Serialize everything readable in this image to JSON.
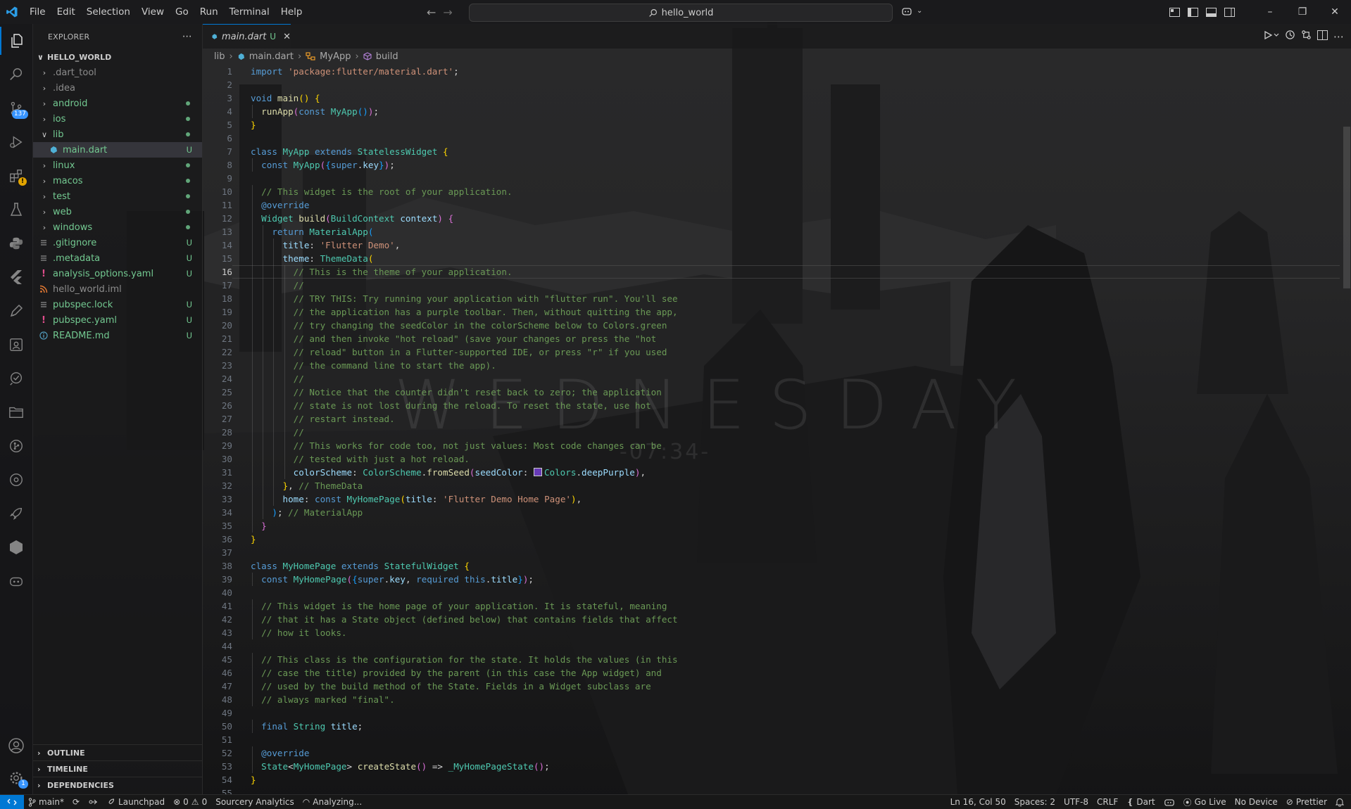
{
  "menu": [
    "File",
    "Edit",
    "Selection",
    "View",
    "Go",
    "Run",
    "Terminal",
    "Help"
  ],
  "command_center": "hello_world",
  "activity": {
    "source_control_badge": "137",
    "settings_badge": "1"
  },
  "explorer": {
    "title": "EXPLORER",
    "root": "HELLO_WORLD",
    "items": [
      {
        "label": ".dart_tool",
        "kind": "folder",
        "open": false,
        "indent": 0,
        "git": "",
        "color": "#8c8c8c",
        "dot": false
      },
      {
        "label": ".idea",
        "kind": "folder",
        "open": false,
        "indent": 0,
        "git": "",
        "color": "#8c8c8c",
        "dot": false
      },
      {
        "label": "android",
        "kind": "folder",
        "open": false,
        "indent": 0,
        "git": "",
        "color": "#73c991",
        "dot": true
      },
      {
        "label": "ios",
        "kind": "folder",
        "open": false,
        "indent": 0,
        "git": "",
        "color": "#73c991",
        "dot": true
      },
      {
        "label": "lib",
        "kind": "folder",
        "open": true,
        "indent": 0,
        "git": "",
        "color": "#73c991",
        "dot": true
      },
      {
        "label": "main.dart",
        "kind": "dart",
        "open": false,
        "indent": 1,
        "git": "U",
        "color": "#73c991",
        "dot": false,
        "selected": true
      },
      {
        "label": "linux",
        "kind": "folder",
        "open": false,
        "indent": 0,
        "git": "",
        "color": "#73c991",
        "dot": true
      },
      {
        "label": "macos",
        "kind": "folder",
        "open": false,
        "indent": 0,
        "git": "",
        "color": "#73c991",
        "dot": true
      },
      {
        "label": "test",
        "kind": "folder",
        "open": false,
        "indent": 0,
        "git": "",
        "color": "#73c991",
        "dot": true
      },
      {
        "label": "web",
        "kind": "folder",
        "open": false,
        "indent": 0,
        "git": "",
        "color": "#73c991",
        "dot": true
      },
      {
        "label": "windows",
        "kind": "folder",
        "open": false,
        "indent": 0,
        "git": "",
        "color": "#73c991",
        "dot": true
      },
      {
        "label": ".gitignore",
        "kind": "lines",
        "open": false,
        "indent": 0,
        "git": "U",
        "color": "#73c991",
        "dot": false
      },
      {
        "label": ".metadata",
        "kind": "lines",
        "open": false,
        "indent": 0,
        "git": "U",
        "color": "#73c991",
        "dot": false
      },
      {
        "label": "analysis_options.yaml",
        "kind": "yaml",
        "open": false,
        "indent": 0,
        "git": "U",
        "color": "#73c991",
        "dot": false
      },
      {
        "label": "hello_world.iml",
        "kind": "rss",
        "open": false,
        "indent": 0,
        "git": "",
        "color": "#8c8c8c",
        "dot": false
      },
      {
        "label": "pubspec.lock",
        "kind": "lines",
        "open": false,
        "indent": 0,
        "git": "U",
        "color": "#73c991",
        "dot": false
      },
      {
        "label": "pubspec.yaml",
        "kind": "yaml",
        "open": false,
        "indent": 0,
        "git": "U",
        "color": "#73c991",
        "dot": false
      },
      {
        "label": "README.md",
        "kind": "info",
        "open": false,
        "indent": 0,
        "git": "U",
        "color": "#73c991",
        "dot": false
      }
    ],
    "bottom_sections": [
      "OUTLINE",
      "TIMELINE",
      "DEPENDENCIES"
    ]
  },
  "tab": {
    "label": "main.dart",
    "status": "U"
  },
  "breadcrumbs": {
    "folder": "lib",
    "file": "main.dart",
    "cls": "MyApp",
    "method": "build"
  },
  "active_line": 16,
  "code": [
    [
      [
        "kw",
        "import "
      ],
      [
        "str",
        "'package:flutter/material.dart'"
      ],
      [
        "pl",
        ";"
      ]
    ],
    [],
    [
      [
        "kw",
        "void "
      ],
      [
        "fn",
        "main"
      ],
      [
        "br1",
        "() {"
      ]
    ],
    [
      [
        "pl",
        "  "
      ],
      [
        "fn",
        "runApp"
      ],
      [
        "br2",
        "("
      ],
      [
        "kw",
        "const "
      ],
      [
        "ty",
        "MyApp"
      ],
      [
        "br3",
        "()"
      ],
      [
        "br2",
        ")"
      ],
      [
        "pl",
        ";"
      ]
    ],
    [
      [
        "br1",
        "}"
      ]
    ],
    [],
    [
      [
        "kw",
        "class "
      ],
      [
        "ty",
        "MyApp "
      ],
      [
        "kw",
        "extends "
      ],
      [
        "ty",
        "StatelessWidget "
      ],
      [
        "br1",
        "{"
      ]
    ],
    [
      [
        "pl",
        "  "
      ],
      [
        "kw",
        "const "
      ],
      [
        "ty",
        "MyApp"
      ],
      [
        "br2",
        "("
      ],
      [
        "br3",
        "{"
      ],
      [
        "kw",
        "super"
      ],
      [
        "pl",
        "."
      ],
      [
        "va",
        "key"
      ],
      [
        "br3",
        "}"
      ],
      [
        "br2",
        ")"
      ],
      [
        "pl",
        ";"
      ]
    ],
    [],
    [
      [
        "cm",
        "  // This widget is the root of your application."
      ]
    ],
    [
      [
        "kw",
        "  @override"
      ]
    ],
    [
      [
        "pl",
        "  "
      ],
      [
        "ty",
        "Widget "
      ],
      [
        "fn",
        "build"
      ],
      [
        "br2",
        "("
      ],
      [
        "ty",
        "BuildContext "
      ],
      [
        "va",
        "context"
      ],
      [
        "br2",
        ") {"
      ]
    ],
    [
      [
        "pl",
        "    "
      ],
      [
        "kw",
        "return "
      ],
      [
        "ty",
        "MaterialApp"
      ],
      [
        "br3",
        "("
      ]
    ],
    [
      [
        "pl",
        "      "
      ],
      [
        "va",
        "title"
      ],
      [
        "pl",
        ": "
      ],
      [
        "str",
        "'Flutter Demo'"
      ],
      [
        "pl",
        ","
      ]
    ],
    [
      [
        "pl",
        "      "
      ],
      [
        "va",
        "theme"
      ],
      [
        "pl",
        ": "
      ],
      [
        "ty",
        "ThemeData"
      ],
      [
        "br1",
        "("
      ]
    ],
    [
      [
        "cm",
        "        // This is the theme of your application."
      ]
    ],
    [
      [
        "cm",
        "        //"
      ]
    ],
    [
      [
        "cm",
        "        // TRY THIS: Try running your application with \"flutter run\". You'll see"
      ]
    ],
    [
      [
        "cm",
        "        // the application has a purple toolbar. Then, without quitting the app,"
      ]
    ],
    [
      [
        "cm",
        "        // try changing the seedColor in the colorScheme below to Colors.green"
      ]
    ],
    [
      [
        "cm",
        "        // and then invoke \"hot reload\" (save your changes or press the \"hot"
      ]
    ],
    [
      [
        "cm",
        "        // reload\" button in a Flutter-supported IDE, or press \"r\" if you used"
      ]
    ],
    [
      [
        "cm",
        "        // the command line to start the app)."
      ]
    ],
    [
      [
        "cm",
        "        //"
      ]
    ],
    [
      [
        "cm",
        "        // Notice that the counter didn't reset back to zero; the application"
      ]
    ],
    [
      [
        "cm",
        "        // state is not lost during the reload. To reset the state, use hot"
      ]
    ],
    [
      [
        "cm",
        "        // restart instead."
      ]
    ],
    [
      [
        "cm",
        "        //"
      ]
    ],
    [
      [
        "cm",
        "        // This works for code too, not just values: Most code changes can be"
      ]
    ],
    [
      [
        "cm",
        "        // tested with just a hot reload."
      ]
    ],
    [
      [
        "pl",
        "        "
      ],
      [
        "va",
        "colorScheme"
      ],
      [
        "pl",
        ": "
      ],
      [
        "ty",
        "ColorScheme"
      ],
      [
        "pl",
        "."
      ],
      [
        "fn",
        "fromSeed"
      ],
      [
        "br2",
        "("
      ],
      [
        "va",
        "seedColor"
      ],
      [
        "pl",
        ": "
      ],
      [
        "sw",
        ""
      ],
      [
        "ty",
        "Colors"
      ],
      [
        "pl",
        "."
      ],
      [
        "va",
        "deepPurple"
      ],
      [
        "br2",
        ")"
      ],
      [
        "pl",
        ","
      ]
    ],
    [
      [
        "pl",
        "      "
      ],
      [
        "br1",
        "}"
      ],
      [
        "pl",
        ", "
      ],
      [
        "cm",
        "// ThemeData"
      ]
    ],
    [
      [
        "pl",
        "      "
      ],
      [
        "va",
        "home"
      ],
      [
        "pl",
        ": "
      ],
      [
        "kw",
        "const "
      ],
      [
        "ty",
        "MyHomePage"
      ],
      [
        "br1",
        "("
      ],
      [
        "va",
        "title"
      ],
      [
        "pl",
        ": "
      ],
      [
        "str",
        "'Flutter Demo Home Page'"
      ],
      [
        "br1",
        ")"
      ],
      [
        "pl",
        ","
      ]
    ],
    [
      [
        "pl",
        "    "
      ],
      [
        "br3",
        ")"
      ],
      [
        "pl",
        "; "
      ],
      [
        "cm",
        "// MaterialApp"
      ]
    ],
    [
      [
        "pl",
        "  "
      ],
      [
        "br2",
        "}"
      ]
    ],
    [
      [
        "br1",
        "}"
      ]
    ],
    [],
    [
      [
        "kw",
        "class "
      ],
      [
        "ty",
        "MyHomePage "
      ],
      [
        "kw",
        "extends "
      ],
      [
        "ty",
        "StatefulWidget "
      ],
      [
        "br1",
        "{"
      ]
    ],
    [
      [
        "pl",
        "  "
      ],
      [
        "kw",
        "const "
      ],
      [
        "ty",
        "MyHomePage"
      ],
      [
        "br2",
        "("
      ],
      [
        "br3",
        "{"
      ],
      [
        "kw",
        "super"
      ],
      [
        "pl",
        "."
      ],
      [
        "va",
        "key"
      ],
      [
        "pl",
        ", "
      ],
      [
        "kw",
        "required "
      ],
      [
        "kw",
        "this"
      ],
      [
        "pl",
        "."
      ],
      [
        "va",
        "title"
      ],
      [
        "br3",
        "}"
      ],
      [
        "br2",
        ")"
      ],
      [
        "pl",
        ";"
      ]
    ],
    [],
    [
      [
        "cm",
        "  // This widget is the home page of your application. It is stateful, meaning"
      ]
    ],
    [
      [
        "cm",
        "  // that it has a State object (defined below) that contains fields that affect"
      ]
    ],
    [
      [
        "cm",
        "  // how it looks."
      ]
    ],
    [],
    [
      [
        "cm",
        "  // This class is the configuration for the state. It holds the values (in this"
      ]
    ],
    [
      [
        "cm",
        "  // case the title) provided by the parent (in this case the App widget) and"
      ]
    ],
    [
      [
        "cm",
        "  // used by the build method of the State. Fields in a Widget subclass are"
      ]
    ],
    [
      [
        "cm",
        "  // always marked \"final\"."
      ]
    ],
    [],
    [
      [
        "pl",
        "  "
      ],
      [
        "kw",
        "final "
      ],
      [
        "ty",
        "String "
      ],
      [
        "va",
        "title"
      ],
      [
        "pl",
        ";"
      ]
    ],
    [],
    [
      [
        "kw",
        "  @override"
      ]
    ],
    [
      [
        "pl",
        "  "
      ],
      [
        "ty",
        "State"
      ],
      [
        "pl",
        "<"
      ],
      [
        "ty",
        "MyHomePage"
      ],
      [
        "pl",
        "> "
      ],
      [
        "fn",
        "createState"
      ],
      [
        "br2",
        "()"
      ],
      [
        "pl",
        " => "
      ],
      [
        "ty",
        "_MyHomePageState"
      ],
      [
        "br2",
        "()"
      ],
      [
        "pl",
        ";"
      ]
    ],
    [
      [
        "br1",
        "}"
      ]
    ],
    []
  ],
  "wallpaper": {
    "word": "WEDNESDAY",
    "time": "-07:34-"
  },
  "status": {
    "branch": "main*",
    "launchpad": "Launchpad",
    "errors": "0",
    "warnings": "0",
    "sourcery": "Sourcery Analytics",
    "analyzing": "Analyzing...",
    "position": "Ln 16, Col 50",
    "spaces": "Spaces: 2",
    "encoding": "UTF-8",
    "eol": "CRLF",
    "language": "Dart",
    "golive": "Go Live",
    "device": "No Device",
    "prettier": "Prettier"
  },
  "colors": {
    "accent": "#0078d4",
    "git_untracked": "#73c991",
    "badge": "#3794ff"
  }
}
